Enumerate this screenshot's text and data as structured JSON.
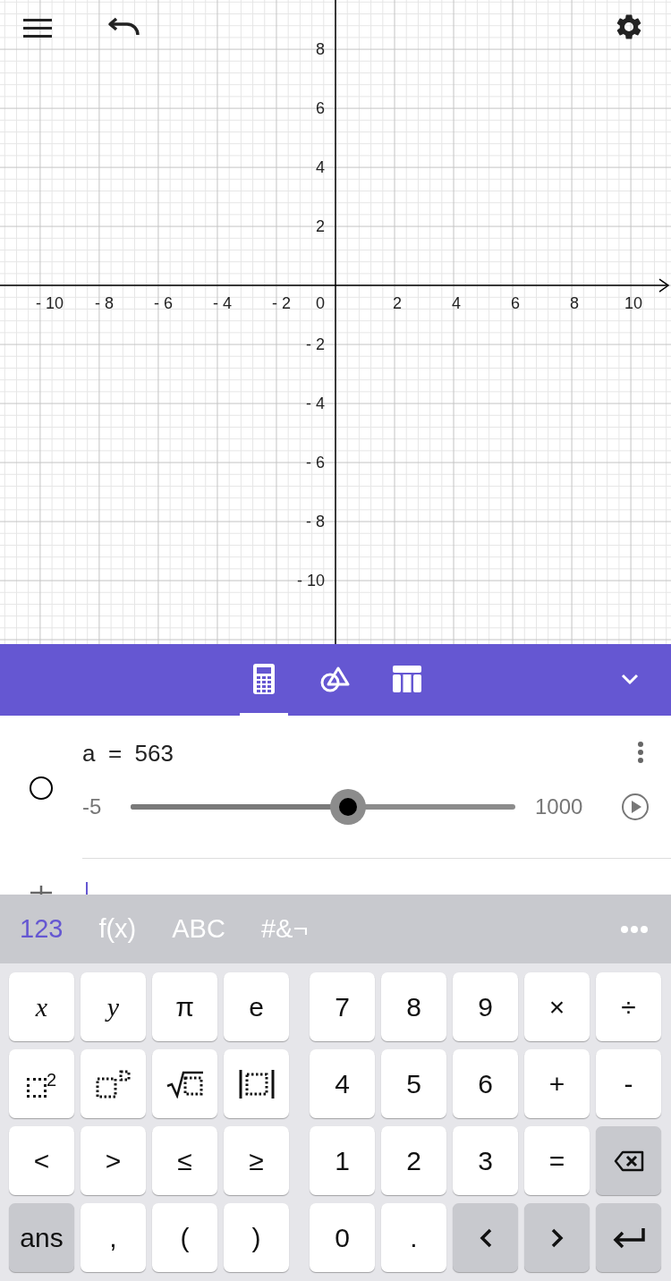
{
  "graph": {
    "origin_label": "0",
    "chart_data": {
      "type": "line",
      "grid": true,
      "xlim": [
        -11.36,
        11.36
      ],
      "ylim": [
        -12.15,
        9.67
      ],
      "xticks": [
        {
          "value": -10,
          "label": "- 10"
        },
        {
          "value": -8,
          "label": "- 8"
        },
        {
          "value": -6,
          "label": "- 6"
        },
        {
          "value": -4,
          "label": "- 4"
        },
        {
          "value": -2,
          "label": "- 2"
        },
        {
          "value": 2,
          "label": "2"
        },
        {
          "value": 4,
          "label": "4"
        },
        {
          "value": 6,
          "label": "6"
        },
        {
          "value": 8,
          "label": "8"
        },
        {
          "value": 10,
          "label": "10"
        }
      ],
      "yticks": [
        {
          "value": 8,
          "label": "8"
        },
        {
          "value": 6,
          "label": "6"
        },
        {
          "value": 4,
          "label": "4"
        },
        {
          "value": 2,
          "label": "2"
        },
        {
          "value": -2,
          "label": "- 2"
        },
        {
          "value": -4,
          "label": "- 4"
        },
        {
          "value": -6,
          "label": "- 6"
        },
        {
          "value": -8,
          "label": "- 8"
        },
        {
          "value": -10,
          "label": "- 10"
        }
      ]
    }
  },
  "toolbar": {
    "tabs": [
      {
        "kind": "calculator",
        "selected": true
      },
      {
        "kind": "shapes",
        "selected": false
      },
      {
        "kind": "table",
        "selected": false
      }
    ]
  },
  "algebra": {
    "entries": [
      {
        "name": "a",
        "operator": "=",
        "value": "563",
        "visible": false,
        "slider": {
          "min": "-5",
          "max": "1000",
          "level": 0.565
        }
      }
    ]
  },
  "keyboard": {
    "tabs": [
      {
        "label": "123",
        "selected": true
      },
      {
        "label": "f(x)",
        "selected": false
      },
      {
        "label": "ABC",
        "selected": false
      },
      {
        "label": "#&¬",
        "selected": false
      }
    ],
    "rows": [
      {
        "left": [
          {
            "kind": "char",
            "label": "x",
            "italic": true
          },
          {
            "kind": "char",
            "label": "y",
            "italic": true
          },
          {
            "kind": "char",
            "label": "π"
          },
          {
            "kind": "char",
            "label": "e"
          }
        ],
        "right": [
          {
            "kind": "char",
            "label": "7"
          },
          {
            "kind": "char",
            "label": "8"
          },
          {
            "kind": "char",
            "label": "9"
          },
          {
            "kind": "char",
            "label": "×"
          },
          {
            "kind": "char",
            "label": "÷"
          }
        ]
      },
      {
        "left": [
          {
            "kind": "square",
            "label": "2"
          },
          {
            "kind": "power"
          },
          {
            "kind": "sqrt"
          },
          {
            "kind": "abs"
          }
        ],
        "right": [
          {
            "kind": "char",
            "label": "4"
          },
          {
            "kind": "char",
            "label": "5"
          },
          {
            "kind": "char",
            "label": "6"
          },
          {
            "kind": "char",
            "label": "+"
          },
          {
            "kind": "char",
            "label": "-"
          }
        ]
      },
      {
        "left": [
          {
            "kind": "char",
            "label": "<"
          },
          {
            "kind": "char",
            "label": ">"
          },
          {
            "kind": "char",
            "label": "≤"
          },
          {
            "kind": "char",
            "label": "≥"
          }
        ],
        "right": [
          {
            "kind": "char",
            "label": "1"
          },
          {
            "kind": "char",
            "label": "2"
          },
          {
            "kind": "char",
            "label": "3"
          },
          {
            "kind": "char",
            "label": "="
          },
          {
            "kind": "backspace",
            "dark": true
          }
        ]
      },
      {
        "left": [
          {
            "kind": "char",
            "label": "ans",
            "dark": true
          },
          {
            "kind": "char",
            "label": ","
          },
          {
            "kind": "char",
            "label": "("
          },
          {
            "kind": "char",
            "label": ")"
          }
        ],
        "right": [
          {
            "kind": "char",
            "label": "0"
          },
          {
            "kind": "char",
            "label": "."
          },
          {
            "kind": "left",
            "dark": true
          },
          {
            "kind": "right",
            "dark": true
          },
          {
            "kind": "enter",
            "dark": true
          }
        ]
      }
    ]
  }
}
